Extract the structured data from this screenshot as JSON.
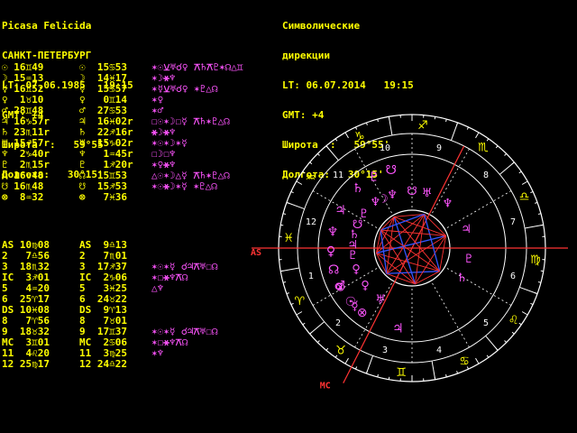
{
  "colors": {
    "background": "#000000",
    "text_yellow": "#ffff00",
    "planet_magenta": "#ff55ff",
    "aspect_red": "#ff3333",
    "aspect_blue": "#3355ff",
    "line_white": "#ffffff",
    "axis_red": "#ff3333"
  },
  "natal": {
    "name": "Picasa Felicida",
    "city": "САНКТ-ПЕТЕРБУРГ",
    "lt": "LT: 07.06.1985   19:15",
    "gmt": "GMT: +4",
    "lat": "Широта  :   59°55'",
    "lon": "Долгота:   30°15'"
  },
  "progressed": {
    "title1": "Символические",
    "title2": "дирекции",
    "lt": "LT: 06.07.2014   19:15",
    "gmt": "GMT: +4",
    "lat": "Широта  :   59°55'",
    "lon": "Долгота:   30°15'"
  },
  "planet_rows": [
    {
      "natal": "☉ 16♊49",
      "prog": "☉  15♋53",
      "aspects": "✶☉⚺♅☌♀ ⚻♄⚻♇✶☊△♊"
    },
    {
      "natal": "☽ 15♒13",
      "prog": "☽  14♓17",
      "aspects": "✶☽⚹♆"
    },
    {
      "natal": "☿ 16♊52",
      "prog": "☿  15♋57",
      "aspects": "✶☿⚺♅☌♀ ✶♇△☊"
    },
    {
      "natal": "♀  1♉10",
      "prog": "♀   0♊14",
      "aspects": "✶♀"
    },
    {
      "natal": "♂ 28♊48",
      "prog": "♂  27♋53",
      "aspects": "✶♂"
    },
    {
      "natal": "♃ 16♑57r",
      "prog": "♃  16♓02r",
      "aspects": "☐☉✶☽☐☿ ⚻♄✶♇△☊"
    },
    {
      "natal": "♄ 23♏11r",
      "prog": "♄  22♐16r",
      "aspects": "⚹☽⚹♆"
    },
    {
      "natal": "♅ 15♐57r",
      "prog": "♅  15♑02r",
      "aspects": "✶☉✶☽✶☿"
    },
    {
      "natal": "♆  2♑40r",
      "prog": "♆   1♒45r",
      "aspects": "☐☽☐♆"
    },
    {
      "natal": "♇  2♏15r",
      "prog": "♇   1♐20r",
      "aspects": "✶♀⚹♆"
    },
    {
      "natal": "☊ 16♉48",
      "prog": "☊  15♊53",
      "aspects": "△☉✶☽△☿ ⚻♄✶♇△☊"
    },
    {
      "natal": "☋ 16♏48",
      "prog": "☋  15♐53",
      "aspects": "✶☉⚹☽✶☿ ✶♇△☊"
    },
    {
      "natal": "⊗  8♒32",
      "prog": "⊗   7♓36",
      "aspects": ""
    }
  ],
  "house_rows": [
    {
      "natal": "AS 10♍08",
      "prog": "AS  9♎13",
      "aspects": ""
    },
    {
      "natal": "2   7♎56",
      "prog": "2   7♏01",
      "aspects": ""
    },
    {
      "natal": "3  18♏32",
      "prog": "3  17♐37",
      "aspects": "✶☉✶☿ ☌♃⚻♅☐☊"
    },
    {
      "natal": "IC  3♐01",
      "prog": "IC  2♑06",
      "aspects": "✶☐⚹♆⚻☊"
    },
    {
      "natal": "5   4♒20",
      "prog": "5   3♓25",
      "aspects": "△♆"
    },
    {
      "natal": "6  25♈17",
      "prog": "6  24♉22",
      "aspects": ""
    },
    {
      "natal": "DS 10♓08",
      "prog": "DS  9♈13",
      "aspects": ""
    },
    {
      "natal": "8   7♈56",
      "prog": "8   7♉01",
      "aspects": ""
    },
    {
      "natal": "9  18♉32",
      "prog": "9  17♊37",
      "aspects": "✶☉✶☿ ☌♃⚻♅☐☊"
    },
    {
      "natal": "MC  3♊01",
      "prog": "MC  2♋06",
      "aspects": "✶☐⚹♆⚻☊"
    },
    {
      "natal": "11  4♌20",
      "prog": "11  3♍25",
      "aspects": "✶♆"
    },
    {
      "natal": "12 25♍17",
      "prog": "12 24♎22",
      "aspects": ""
    }
  ],
  "wheel": {
    "mc_label": "MC",
    "as_label": "AS",
    "as_deg": 10,
    "mc_deg": 63,
    "house_numbers": [
      "1",
      "2",
      "3",
      "4",
      "5",
      "6",
      "7",
      "8",
      "9",
      "10",
      "11",
      "12"
    ],
    "zodiac_signs": [
      "♈",
      "♉",
      "♊",
      "♋",
      "♌",
      "♍",
      "♎",
      "♏",
      "♐",
      "♑",
      "♒",
      "♓"
    ],
    "outer_planets": [
      {
        "glyph": "♃",
        "deg": 80
      },
      {
        "glyph": "⊗",
        "deg": 52
      },
      {
        "glyph": "☿",
        "deg": 45
      },
      {
        "glyph": "☉",
        "deg": 41
      },
      {
        "glyph": "♂",
        "deg": 27
      },
      {
        "glyph": "⊗",
        "deg": 28
      },
      {
        "glyph": "☊",
        "deg": 15
      },
      {
        "glyph": "♀",
        "deg": 2
      },
      {
        "glyph": "♆",
        "deg": -12
      },
      {
        "glyph": "♃",
        "deg": -28
      },
      {
        "glyph": "♄",
        "deg": -48
      },
      {
        "glyph": "♇",
        "deg": -62
      },
      {
        "glyph": "☋",
        "deg": -75
      }
    ],
    "inner_planets": [
      {
        "glyph": "♅",
        "deg": 58
      },
      {
        "glyph": "♀",
        "deg": 38
      },
      {
        "glyph": "♀",
        "deg": 20
      },
      {
        "glyph": "♇",
        "deg": 6
      },
      {
        "glyph": "♃",
        "deg": -4
      },
      {
        "glyph": "♄",
        "deg": -14
      },
      {
        "glyph": "☋",
        "deg": -24
      },
      {
        "glyph": "♇",
        "deg": -36
      },
      {
        "glyph": "♆",
        "deg": -52
      }
    ],
    "center_planets": [
      {
        "glyph": "♇",
        "deg": 170
      },
      {
        "glyph": "♄",
        "deg": 150
      },
      {
        "glyph": "♃",
        "deg": 200
      },
      {
        "glyph": "♆",
        "deg": 232
      },
      {
        "glyph": "♅",
        "deg": 255
      },
      {
        "glyph": "♆",
        "deg": 290
      },
      {
        "glyph": "☋",
        "deg": 270
      },
      {
        "glyph": "☽",
        "deg": 300
      }
    ]
  }
}
